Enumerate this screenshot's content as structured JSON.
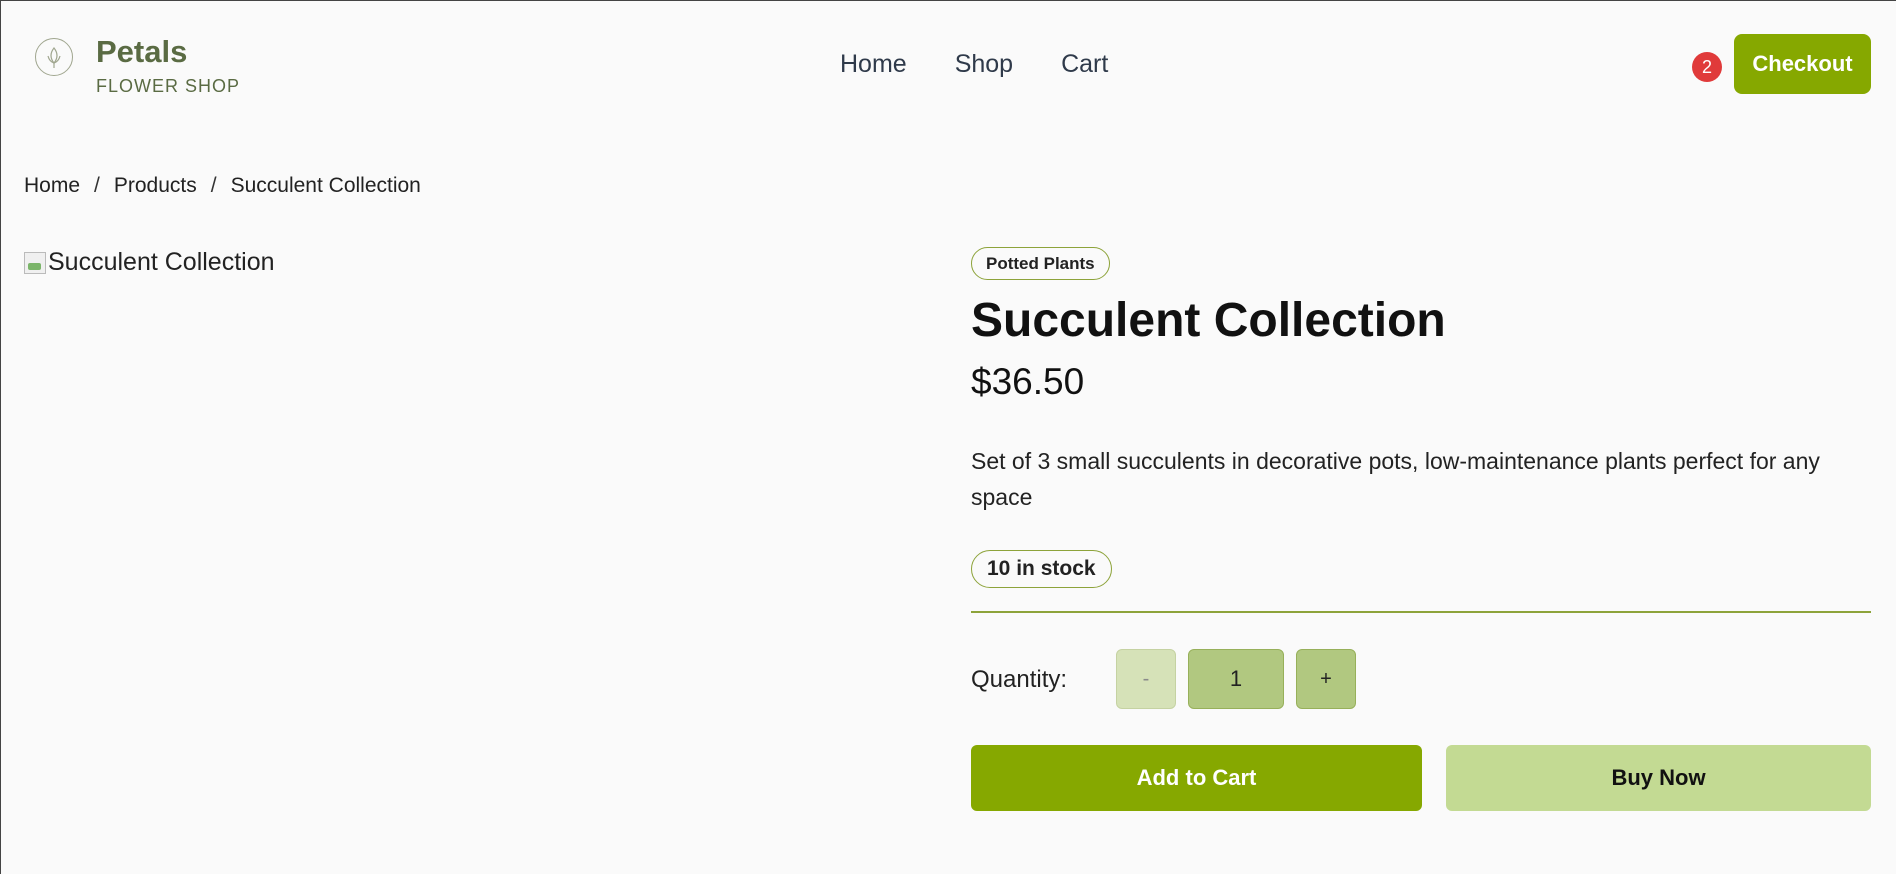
{
  "brand": {
    "name": "Petals",
    "subtitle": "FLOWER SHOP",
    "logo_icon": "flower-icon",
    "color": "#5a6b43"
  },
  "nav": {
    "items": [
      {
        "label": "Home"
      },
      {
        "label": "Shop"
      },
      {
        "label": "Cart"
      }
    ]
  },
  "header": {
    "cart_count": "2",
    "checkout_label": "Checkout",
    "accent_color": "#86a800",
    "badge_color": "#e03a3a"
  },
  "breadcrumb": {
    "items": [
      "Home",
      "Products",
      "Succulent Collection"
    ],
    "separator": "/"
  },
  "product": {
    "image_alt": "Succulent Collection",
    "category": "Potted Plants",
    "title": "Succulent Collection",
    "price": "$36.50",
    "description": "Set of 3 small succulents in decorative pots, low-maintenance plants perfect for any space",
    "stock": "10 in stock"
  },
  "quantity": {
    "label": "Quantity:",
    "value": "1",
    "minus_label": "-",
    "plus_label": "+"
  },
  "actions": {
    "add_to_cart_label": "Add to Cart",
    "buy_now_label": "Buy Now"
  }
}
